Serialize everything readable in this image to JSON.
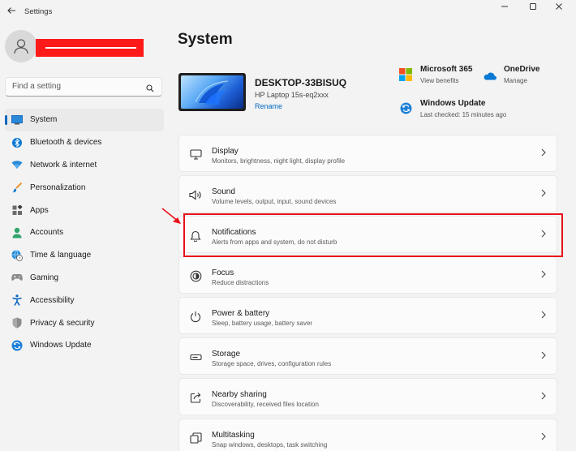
{
  "window": {
    "app_title": "Settings",
    "back_icon": "back-arrow-icon",
    "controls": [
      "minimize",
      "maximize",
      "close"
    ]
  },
  "sidebar": {
    "search_placeholder": "Find a setting",
    "items": [
      {
        "label": "System",
        "icon": "monitor-icon",
        "active": true
      },
      {
        "label": "Bluetooth & devices",
        "icon": "bluetooth-icon"
      },
      {
        "label": "Network & internet",
        "icon": "wifi-icon"
      },
      {
        "label": "Personalization",
        "icon": "brush-icon"
      },
      {
        "label": "Apps",
        "icon": "apps-icon"
      },
      {
        "label": "Accounts",
        "icon": "person-icon"
      },
      {
        "label": "Time & language",
        "icon": "globe-clock-icon"
      },
      {
        "label": "Gaming",
        "icon": "gamepad-icon"
      },
      {
        "label": "Accessibility",
        "icon": "accessibility-icon"
      },
      {
        "label": "Privacy & security",
        "icon": "shield-icon"
      },
      {
        "label": "Windows Update",
        "icon": "update-icon"
      }
    ]
  },
  "main": {
    "title": "System",
    "device": {
      "name": "DESKTOP-33BISUQ",
      "model": "HP Laptop 15s-eq2xxx",
      "rename": "Rename"
    },
    "quick_links": [
      {
        "title": "Microsoft 365",
        "sub": "View benefits",
        "icon": "microsoft-365-icon"
      },
      {
        "title": "OneDrive",
        "sub": "Manage",
        "icon": "onedrive-icon"
      },
      {
        "title": "Windows Update",
        "sub": "Last checked: 15 minutes ago",
        "icon": "update-icon"
      }
    ],
    "cards": [
      {
        "title": "Display",
        "sub": "Monitors, brightness, night light, display profile",
        "icon": "display-icon"
      },
      {
        "title": "Sound",
        "sub": "Volume levels, output, input, sound devices",
        "icon": "speaker-icon"
      },
      {
        "title": "Notifications",
        "sub": "Alerts from apps and system, do not disturb",
        "icon": "bell-icon"
      },
      {
        "title": "Focus",
        "sub": "Reduce distractions",
        "icon": "focus-icon"
      },
      {
        "title": "Power & battery",
        "sub": "Sleep, battery usage, battery saver",
        "icon": "power-icon"
      },
      {
        "title": "Storage",
        "sub": "Storage space, drives, configuration rules",
        "icon": "storage-icon"
      },
      {
        "title": "Nearby sharing",
        "sub": "Discoverability, received files location",
        "icon": "share-icon"
      },
      {
        "title": "Multitasking",
        "sub": "Snap windows, desktops, task switching",
        "icon": "multitasking-icon"
      }
    ]
  },
  "colors": {
    "accent": "#0067c0",
    "highlight": "#e8121a",
    "redaction": "#ff1a1a"
  }
}
